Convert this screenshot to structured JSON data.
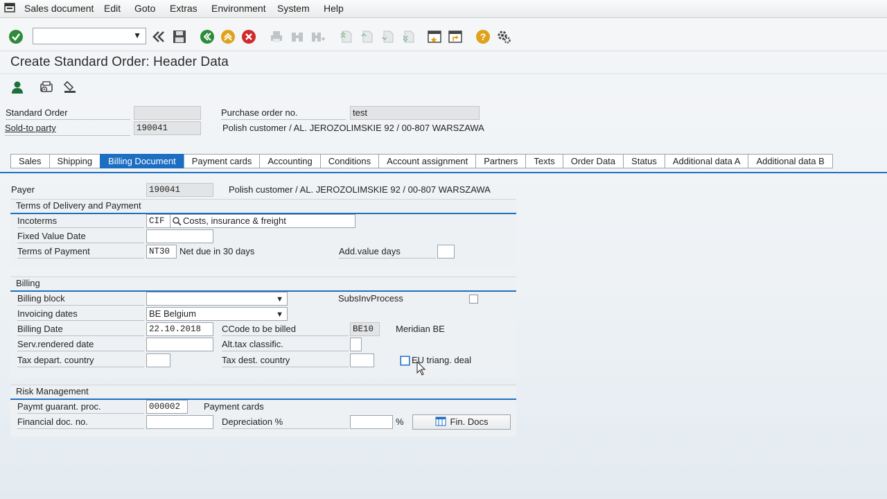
{
  "menu": {
    "items": [
      "Sales document",
      "Edit",
      "Goto",
      "Extras",
      "Environment",
      "System",
      "Help"
    ]
  },
  "toolbar": {
    "command_field_value": "",
    "icons": [
      "enter-icon",
      "back-icon",
      "save-icon",
      "back-green-icon",
      "exit-icon",
      "cancel-icon",
      "print-icon",
      "find-icon",
      "find-next-icon",
      "first-page-icon",
      "prev-page-icon",
      "next-page-icon",
      "last-page-icon",
      "new-session-icon",
      "shortcut-icon",
      "help-icon",
      "customize-icon"
    ]
  },
  "page_title": "Create Standard Order: Header Data",
  "header": {
    "standard_order_label": "Standard Order",
    "standard_order_value": "",
    "po_label": "Purchase order no.",
    "po_value": "test",
    "sold_to_label": "Sold-to party",
    "sold_to_value": "190041",
    "sold_to_desc": "Polish customer / AL. JEROZOLIMSKIE 92 / 00-807 WARSZAWA"
  },
  "tabs": [
    {
      "label": "Sales"
    },
    {
      "label": "Shipping"
    },
    {
      "label": "Billing Document"
    },
    {
      "label": "Payment cards"
    },
    {
      "label": "Accounting"
    },
    {
      "label": "Conditions"
    },
    {
      "label": "Account assignment"
    },
    {
      "label": "Partners"
    },
    {
      "label": "Texts"
    },
    {
      "label": "Order Data"
    },
    {
      "label": "Status"
    },
    {
      "label": "Additional data A"
    },
    {
      "label": "Additional data B"
    }
  ],
  "active_tab": "Billing Document",
  "payer": {
    "label": "Payer",
    "value": "190041",
    "desc": "Polish customer / AL. JEROZOLIMSKIE 92 / 00-807 WARSZAWA"
  },
  "delivery": {
    "title": "Terms of Delivery and Payment",
    "incoterms_label": "Incoterms",
    "incoterms_value": "CIF",
    "incoterms_desc": "Costs, insurance & freight",
    "fixed_value_date_label": "Fixed Value Date",
    "fixed_value_date_value": "",
    "terms_of_payment_label": "Terms of Payment",
    "terms_of_payment_value": "NT30",
    "terms_of_payment_desc": "Net due in 30 days",
    "add_value_days_label": "Add.value days",
    "add_value_days_value": ""
  },
  "billing": {
    "title": "Billing",
    "billing_block_label": "Billing block",
    "billing_block_value": "",
    "subs_inv_label": "SubsInvProcess",
    "invoicing_dates_label": "Invoicing dates",
    "invoicing_dates_value": "BE Belgium",
    "billing_date_label": "Billing Date",
    "billing_date_value": "22.10.2018",
    "ccode_label": "CCode to be billed",
    "ccode_value": "BE10",
    "ccode_desc": "Meridian BE",
    "serv_rendered_label": "Serv.rendered date",
    "serv_rendered_value": "",
    "alt_tax_label": "Alt.tax classific.",
    "alt_tax_value": "",
    "tax_depart_label": "Tax depart. country",
    "tax_depart_value": "",
    "tax_dest_label": "Tax dest. country",
    "tax_dest_value": "",
    "eu_triang_label": "EU triang. deal"
  },
  "risk": {
    "title": "Risk Management",
    "paymt_guarant_label": "Paymt guarant. proc.",
    "paymt_guarant_value": "000002",
    "paymt_guarant_desc": "Payment cards",
    "fin_doc_label": "Financial doc. no.",
    "fin_doc_value": "",
    "depreciation_label": "Depreciation %",
    "depreciation_value": "",
    "percent_sign": "%",
    "fin_docs_button": "Fin. Docs"
  },
  "colors": {
    "accent": "#1f6fc0",
    "ok_green": "#2e8b3a",
    "cancel_red": "#d02a2a",
    "help_orange": "#e0a21a"
  }
}
